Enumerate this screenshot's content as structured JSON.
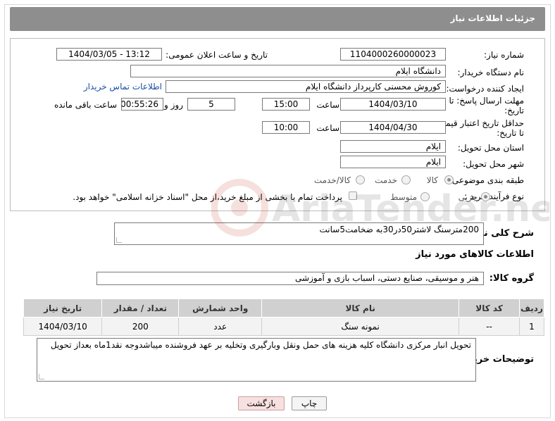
{
  "header": {
    "title": "جزئیات اطلاعات نیاز"
  },
  "form": {
    "need_number_label": "شماره نیاز:",
    "need_number": "1104000260000023",
    "announce_label": "تاریخ و ساعت اعلان عمومی:",
    "announce_value": "1404/03/05 - 13:12",
    "buyer_org_label": "نام دستگاه خریدار:",
    "buyer_org": "دانشگاه ایلام",
    "creator_label": "ایجاد کننده درخواست:",
    "creator": "کوروش محسنی کارپرداز دانشگاه ایلام",
    "contact_link": "اطلاعات تماس خریدار",
    "deadline_label_1": "مهلت ارسال پاسخ: تا",
    "deadline_label_2": "تاریخ:",
    "deadline_date": "1404/03/10",
    "time_label": "ساعت",
    "deadline_time": "15:00",
    "days_value": "5",
    "days_label": "روز و",
    "remaining_value": "00:55:26",
    "remaining_label": "ساعت باقی مانده",
    "validity_label_1": "حداقل تاریخ اعتبار قیمت:",
    "validity_label_2": "تا تاریخ:",
    "validity_date": "1404/04/30",
    "validity_time": "10:00",
    "province_label": "استان محل تحویل:",
    "province": "ایلام",
    "city_label": "شهر محل تحویل:",
    "city": "ایلام",
    "category_label": "طبقه بندی موضوعی:",
    "category_options": [
      "کالا",
      "خدمت",
      "کالا/خدمت"
    ],
    "process_label": "نوع فرآیند خرید :",
    "process_options": [
      "جزیی",
      "متوسط"
    ],
    "payment_note": "پرداخت تمام یا بخشی از مبلغ خرید،از محل \"اسناد خزانه اسلامی\" خواهد بود."
  },
  "summary": {
    "label": "شرح کلی نیاز:",
    "text": "200مترسنگ لاشتر50در30به ضخامت5سانت"
  },
  "goods_section": {
    "title": "اطلاعات کالاهای مورد نیاز",
    "group_label": "گروه کالا:",
    "group_value": "هنر و موسیقی، صنایع دستی، اسباب بازی و آموزشی"
  },
  "table": {
    "headers": [
      "ردیف",
      "کد کالا",
      "نام کالا",
      "واحد شمارش",
      "تعداد / مقدار",
      "تاریخ نیاز"
    ],
    "rows": [
      [
        "1",
        "--",
        "نمونه سنگ",
        "عدد",
        "200",
        "1404/03/10"
      ]
    ]
  },
  "notes": {
    "label": "توضیحات خریدار:",
    "text": "تحویل انبار مرکزی دانشگاه کلیه هزینه های حمل ونقل وبارگیری وتخلیه بر عهد فروشنده میباشدوجه نقد1ماه بعداز تحویل"
  },
  "buttons": {
    "print": "چاپ",
    "back": "بازگشت"
  },
  "watermark": {
    "text": "AriaTender.neT"
  }
}
